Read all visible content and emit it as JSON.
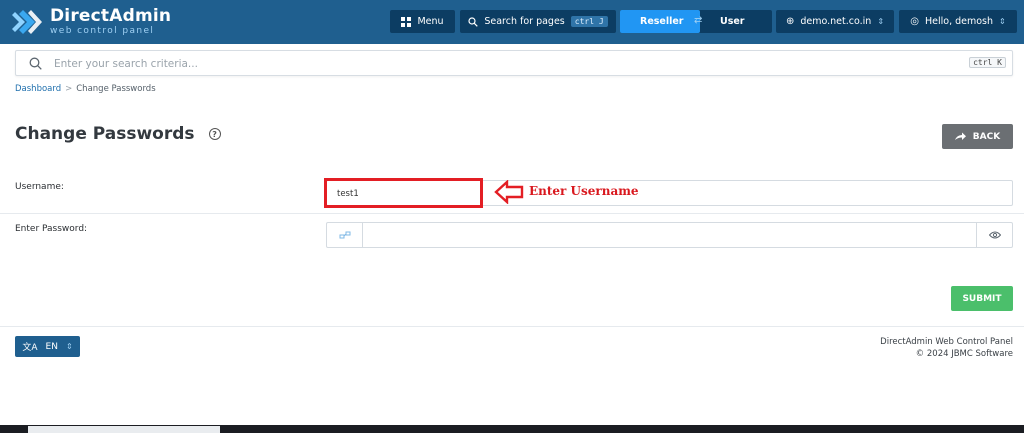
{
  "brand": {
    "title": "DirectAdmin",
    "subtitle": "web control panel"
  },
  "topbar": {
    "menu_label": "Menu",
    "search_label": "Search for pages",
    "search_kbd": "ctrl J",
    "reseller_label": "Reseller",
    "user_label": "User",
    "domain_label": "demo.net.co.in",
    "hello_label": "Hello, demosh"
  },
  "search": {
    "placeholder": "Enter your search criteria...",
    "kbd": "ctrl K"
  },
  "breadcrumb": {
    "home": "Dashboard",
    "separator": ">",
    "current": "Change Passwords"
  },
  "page": {
    "title": "Change Passwords",
    "back_label": "BACK"
  },
  "form": {
    "username_label": "Username:",
    "username_value": "test1",
    "password_label": "Enter Password:",
    "password_value": "",
    "submit_label": "SUBMIT"
  },
  "annotation": {
    "text": "Enter Username",
    "color": "#e31e24"
  },
  "footer": {
    "lang_label": "EN",
    "line1": "DirectAdmin Web Control Panel",
    "line2": "© 2024 JBMC Software"
  },
  "colors": {
    "topbar": "#1f5f8f",
    "accent": "#2196f3",
    "submit": "#4bbf6b",
    "back": "#6b6f73"
  }
}
